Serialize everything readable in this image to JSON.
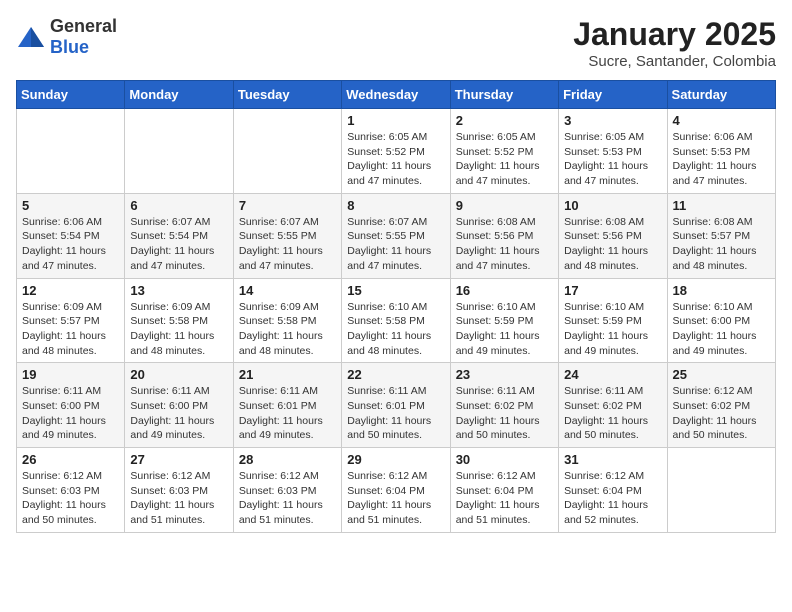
{
  "header": {
    "logo": {
      "general": "General",
      "blue": "Blue"
    },
    "month": "January 2025",
    "location": "Sucre, Santander, Colombia"
  },
  "weekdays": [
    "Sunday",
    "Monday",
    "Tuesday",
    "Wednesday",
    "Thursday",
    "Friday",
    "Saturday"
  ],
  "weeks": [
    [
      {
        "day": "",
        "info": ""
      },
      {
        "day": "",
        "info": ""
      },
      {
        "day": "",
        "info": ""
      },
      {
        "day": "1",
        "sunrise": "Sunrise: 6:05 AM",
        "sunset": "Sunset: 5:52 PM",
        "daylight": "Daylight: 11 hours and 47 minutes."
      },
      {
        "day": "2",
        "sunrise": "Sunrise: 6:05 AM",
        "sunset": "Sunset: 5:52 PM",
        "daylight": "Daylight: 11 hours and 47 minutes."
      },
      {
        "day": "3",
        "sunrise": "Sunrise: 6:05 AM",
        "sunset": "Sunset: 5:53 PM",
        "daylight": "Daylight: 11 hours and 47 minutes."
      },
      {
        "day": "4",
        "sunrise": "Sunrise: 6:06 AM",
        "sunset": "Sunset: 5:53 PM",
        "daylight": "Daylight: 11 hours and 47 minutes."
      }
    ],
    [
      {
        "day": "5",
        "sunrise": "Sunrise: 6:06 AM",
        "sunset": "Sunset: 5:54 PM",
        "daylight": "Daylight: 11 hours and 47 minutes."
      },
      {
        "day": "6",
        "sunrise": "Sunrise: 6:07 AM",
        "sunset": "Sunset: 5:54 PM",
        "daylight": "Daylight: 11 hours and 47 minutes."
      },
      {
        "day": "7",
        "sunrise": "Sunrise: 6:07 AM",
        "sunset": "Sunset: 5:55 PM",
        "daylight": "Daylight: 11 hours and 47 minutes."
      },
      {
        "day": "8",
        "sunrise": "Sunrise: 6:07 AM",
        "sunset": "Sunset: 5:55 PM",
        "daylight": "Daylight: 11 hours and 47 minutes."
      },
      {
        "day": "9",
        "sunrise": "Sunrise: 6:08 AM",
        "sunset": "Sunset: 5:56 PM",
        "daylight": "Daylight: 11 hours and 47 minutes."
      },
      {
        "day": "10",
        "sunrise": "Sunrise: 6:08 AM",
        "sunset": "Sunset: 5:56 PM",
        "daylight": "Daylight: 11 hours and 48 minutes."
      },
      {
        "day": "11",
        "sunrise": "Sunrise: 6:08 AM",
        "sunset": "Sunset: 5:57 PM",
        "daylight": "Daylight: 11 hours and 48 minutes."
      }
    ],
    [
      {
        "day": "12",
        "sunrise": "Sunrise: 6:09 AM",
        "sunset": "Sunset: 5:57 PM",
        "daylight": "Daylight: 11 hours and 48 minutes."
      },
      {
        "day": "13",
        "sunrise": "Sunrise: 6:09 AM",
        "sunset": "Sunset: 5:58 PM",
        "daylight": "Daylight: 11 hours and 48 minutes."
      },
      {
        "day": "14",
        "sunrise": "Sunrise: 6:09 AM",
        "sunset": "Sunset: 5:58 PM",
        "daylight": "Daylight: 11 hours and 48 minutes."
      },
      {
        "day": "15",
        "sunrise": "Sunrise: 6:10 AM",
        "sunset": "Sunset: 5:58 PM",
        "daylight": "Daylight: 11 hours and 48 minutes."
      },
      {
        "day": "16",
        "sunrise": "Sunrise: 6:10 AM",
        "sunset": "Sunset: 5:59 PM",
        "daylight": "Daylight: 11 hours and 49 minutes."
      },
      {
        "day": "17",
        "sunrise": "Sunrise: 6:10 AM",
        "sunset": "Sunset: 5:59 PM",
        "daylight": "Daylight: 11 hours and 49 minutes."
      },
      {
        "day": "18",
        "sunrise": "Sunrise: 6:10 AM",
        "sunset": "Sunset: 6:00 PM",
        "daylight": "Daylight: 11 hours and 49 minutes."
      }
    ],
    [
      {
        "day": "19",
        "sunrise": "Sunrise: 6:11 AM",
        "sunset": "Sunset: 6:00 PM",
        "daylight": "Daylight: 11 hours and 49 minutes."
      },
      {
        "day": "20",
        "sunrise": "Sunrise: 6:11 AM",
        "sunset": "Sunset: 6:00 PM",
        "daylight": "Daylight: 11 hours and 49 minutes."
      },
      {
        "day": "21",
        "sunrise": "Sunrise: 6:11 AM",
        "sunset": "Sunset: 6:01 PM",
        "daylight": "Daylight: 11 hours and 49 minutes."
      },
      {
        "day": "22",
        "sunrise": "Sunrise: 6:11 AM",
        "sunset": "Sunset: 6:01 PM",
        "daylight": "Daylight: 11 hours and 50 minutes."
      },
      {
        "day": "23",
        "sunrise": "Sunrise: 6:11 AM",
        "sunset": "Sunset: 6:02 PM",
        "daylight": "Daylight: 11 hours and 50 minutes."
      },
      {
        "day": "24",
        "sunrise": "Sunrise: 6:11 AM",
        "sunset": "Sunset: 6:02 PM",
        "daylight": "Daylight: 11 hours and 50 minutes."
      },
      {
        "day": "25",
        "sunrise": "Sunrise: 6:12 AM",
        "sunset": "Sunset: 6:02 PM",
        "daylight": "Daylight: 11 hours and 50 minutes."
      }
    ],
    [
      {
        "day": "26",
        "sunrise": "Sunrise: 6:12 AM",
        "sunset": "Sunset: 6:03 PM",
        "daylight": "Daylight: 11 hours and 50 minutes."
      },
      {
        "day": "27",
        "sunrise": "Sunrise: 6:12 AM",
        "sunset": "Sunset: 6:03 PM",
        "daylight": "Daylight: 11 hours and 51 minutes."
      },
      {
        "day": "28",
        "sunrise": "Sunrise: 6:12 AM",
        "sunset": "Sunset: 6:03 PM",
        "daylight": "Daylight: 11 hours and 51 minutes."
      },
      {
        "day": "29",
        "sunrise": "Sunrise: 6:12 AM",
        "sunset": "Sunset: 6:04 PM",
        "daylight": "Daylight: 11 hours and 51 minutes."
      },
      {
        "day": "30",
        "sunrise": "Sunrise: 6:12 AM",
        "sunset": "Sunset: 6:04 PM",
        "daylight": "Daylight: 11 hours and 51 minutes."
      },
      {
        "day": "31",
        "sunrise": "Sunrise: 6:12 AM",
        "sunset": "Sunset: 6:04 PM",
        "daylight": "Daylight: 11 hours and 52 minutes."
      },
      {
        "day": "",
        "info": ""
      }
    ]
  ]
}
